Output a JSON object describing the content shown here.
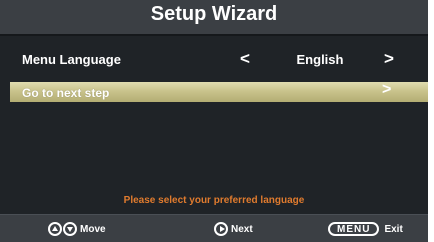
{
  "title": "Setup Wizard",
  "language_row": {
    "label": "Menu Language",
    "left_arrow": "<",
    "value": "English",
    "right_arrow": ">"
  },
  "next_step_row": {
    "label": "Go to next step",
    "arrow": ">"
  },
  "hint": "Please select your preferred language",
  "footer": {
    "move_label": "Move",
    "next_label": "Next",
    "menu_key": "MENU",
    "exit_label": "Exit"
  },
  "colors": {
    "panel_bg": "#1f2327",
    "bar_bg": "#3b3f44",
    "highlight": "#c9c38c",
    "hint_text": "#e07b2e"
  }
}
